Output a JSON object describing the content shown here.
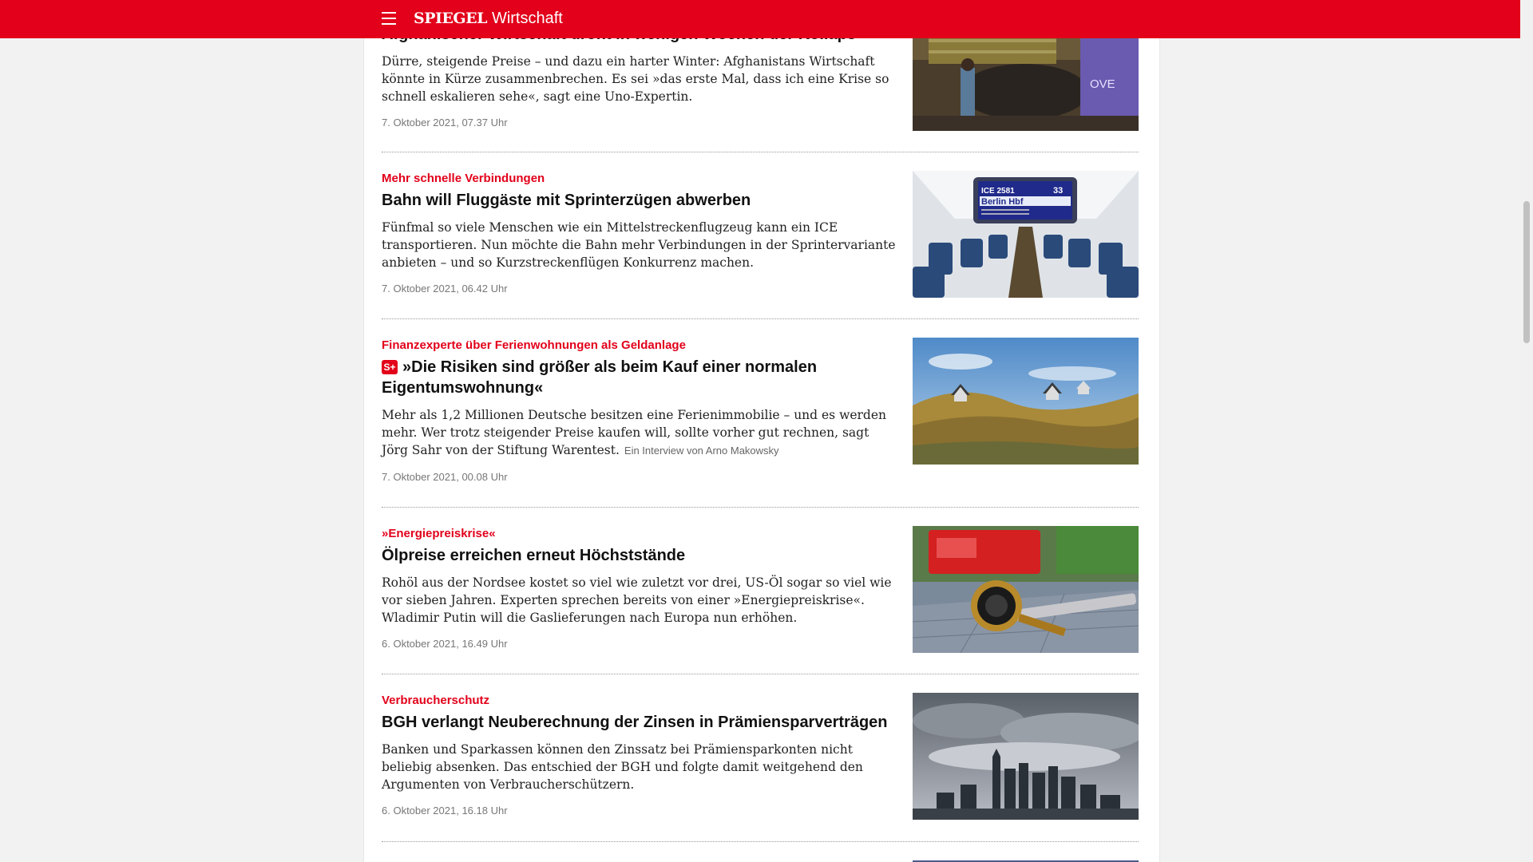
{
  "header": {
    "logo": "SPIEGEL",
    "section": "Wirtschaft",
    "brand_color": "#e2001a"
  },
  "articles": [
    {
      "headline": "Afghanischer Wirtschaft droht in wenigen Wochen der Kollaps",
      "teaser": "Dürre, steigende Preise – und dazu ein harter Winter: Afghanistans Wirtschaft könnte in Kürze zusammenbrechen. Es sei »das erste Mal, dass ich eine Krise so schnell eskalieren sehe«, sagt eine Uno-Expertin.",
      "date": "7. Oktober 2021, 07.37 Uhr"
    },
    {
      "kicker": "Mehr schnelle Verbindungen",
      "headline": "Bahn will Fluggäste mit Sprinterzügen abwerben",
      "teaser": "Fünfmal so viele Menschen wie ein Mittelstreckenflugzeug kann ein ICE transportieren. Nun möchte die Bahn mehr Verbindungen in der Sprintervariante anbieten – und so Kurzstreckenflügen Konkurrenz machen.",
      "date": "7. Oktober 2021, 06.42 Uhr",
      "image_text": {
        "train": "ICE 2581",
        "dest": "Berlin Hbf",
        "car": "33"
      }
    },
    {
      "kicker": "Finanzexperte über Ferienwohnungen als Geldanlage",
      "badge": "S+",
      "headline": "»Die Risiken sind größer als beim Kauf einer normalen Eigentumswohnung«",
      "teaser": "Mehr als 1,2 Millionen Deutsche besitzen eine Ferienimmobilie – und es werden mehr. Wer trotz steigender Preise kaufen will, sollte vorher gut rechnen, sagt Jörg Sahr von der Stiftung Warentest.",
      "byline": "Ein Interview von Arno Makowsky",
      "date": "7. Oktober 2021, 00.08 Uhr"
    },
    {
      "kicker": "»Energiepreiskrise«",
      "headline": "Ölpreise erreichen erneut Höchststände",
      "teaser": "Rohöl aus der Nordsee kostet so viel wie zuletzt vor drei, US-Öl sogar so viel wie vor sieben Jahren. Experten sprechen bereits von einer »Energiepreiskrise«. Wladimir Putin will die Gaslieferungen nach Europa nun erhöhen.",
      "date": "6. Oktober 2021, 16.49 Uhr"
    },
    {
      "kicker": "Verbraucherschutz",
      "headline": "BGH verlangt Neuberechnung der Zinsen in Prämiensparverträgen",
      "teaser": "Banken und Sparkassen können den Zinssatz bei Prämiensparkonten nicht beliebig absenken. Das entschied der BGH und folgte damit weitgehend den Argumenten von Verbraucherschützern.",
      "date": "6. Oktober 2021, 16.18 Uhr"
    }
  ]
}
